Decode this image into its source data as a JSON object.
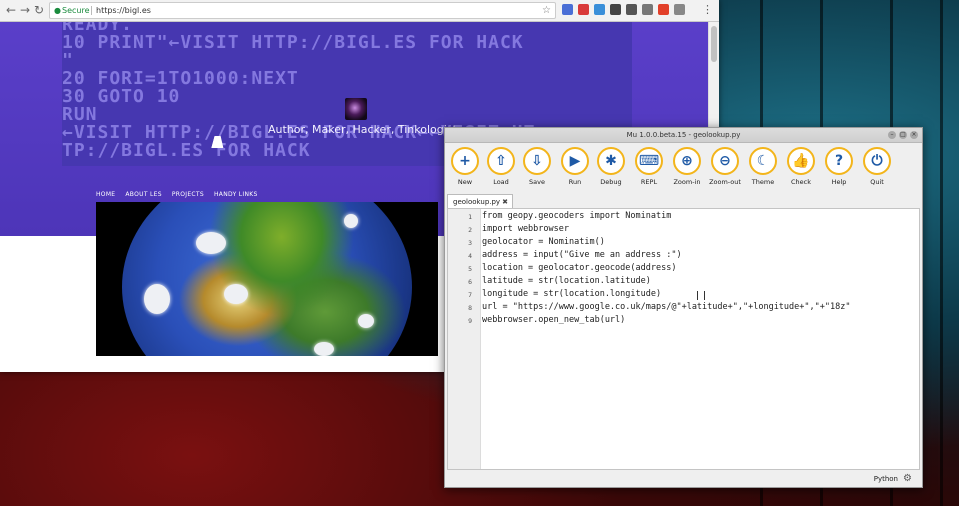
{
  "browser": {
    "nav": {
      "back": "←",
      "forward": "→",
      "reload": "↻"
    },
    "omnibox": {
      "secure_label": "Secure",
      "url": "https://bigl.es"
    },
    "extensions": [
      {
        "name": "ext-1",
        "color": "#4a6fd6"
      },
      {
        "name": "ext-2",
        "color": "#d93a3a"
      },
      {
        "name": "ext-3",
        "color": "#3a8fd9"
      },
      {
        "name": "ext-4",
        "color": "#444444"
      },
      {
        "name": "ext-5",
        "color": "#555555"
      },
      {
        "name": "ext-6",
        "color": "#777777"
      },
      {
        "name": "ext-7",
        "color": "#e2402a"
      },
      {
        "name": "ext-8",
        "color": "#888888"
      }
    ],
    "menu_icon": "⋮",
    "page": {
      "c64_lines": [
        "READY.",
        "10 PRINT\"←VISIT HTTP://BIGL.ES FOR HACK",
        "\"",
        "20 FORI=1TO1000:NEXT",
        "30 GOTO 10",
        "RUN",
        "←VISIT HTTP://BIGL.ES FOR HACK←←VISIT HT",
        "TP://BIGL.ES FOR HACK"
      ],
      "tagline": "Author, Maker, Hacker, Tinkologist",
      "nav": [
        "HOME",
        "ABOUT LES",
        "PROJECTS",
        "HANDY LINKS"
      ]
    }
  },
  "mu": {
    "title": "Mu 1.0.0.beta.15 - geolookup.py",
    "window_buttons": [
      "–",
      "□",
      "×"
    ],
    "toolbar": [
      {
        "label": "New",
        "icon": "+",
        "name": "new"
      },
      {
        "label": "Load",
        "icon": "⇧",
        "name": "load"
      },
      {
        "label": "Save",
        "icon": "⇩",
        "name": "save"
      },
      {
        "label": "Run",
        "icon": "▶",
        "name": "run"
      },
      {
        "label": "Debug",
        "icon": "✱",
        "name": "debug"
      },
      {
        "label": "REPL",
        "icon": "⌨",
        "name": "repl"
      },
      {
        "label": "Zoom-in",
        "icon": "⊕",
        "name": "zoom-in"
      },
      {
        "label": "Zoom-out",
        "icon": "⊖",
        "name": "zoom-out"
      },
      {
        "label": "Theme",
        "icon": "☾",
        "name": "theme"
      },
      {
        "label": "Check",
        "icon": "👍",
        "name": "check"
      },
      {
        "label": "Help",
        "icon": "?",
        "name": "help"
      },
      {
        "label": "Quit",
        "icon": "⏻",
        "name": "quit"
      }
    ],
    "tab": {
      "label": "geolookup.py",
      "close": "✖"
    },
    "code_lines": [
      {
        "n": "1",
        "text": "from geopy.geocoders import Nominatim"
      },
      {
        "n": "2",
        "text": "import webbrowser"
      },
      {
        "n": "3",
        "text": "geolocator = Nominatim()"
      },
      {
        "n": "4",
        "text": "address = input(\"Give me an address :\")"
      },
      {
        "n": "5",
        "text": "location = geolocator.geocode(address)"
      },
      {
        "n": "6",
        "text": "latitude = str(location.latitude)"
      },
      {
        "n": "7",
        "text": "longitude = str(location.longitude)"
      },
      {
        "n": "8",
        "text": "url = \"https://www.google.co.uk/maps/@\"+latitude+\",\"+longitude+\",\"+\"18z\""
      },
      {
        "n": "9",
        "text": "webbrowser.open_new_tab(url)"
      }
    ],
    "status": {
      "mode": "Python",
      "gear": "⚙"
    }
  }
}
